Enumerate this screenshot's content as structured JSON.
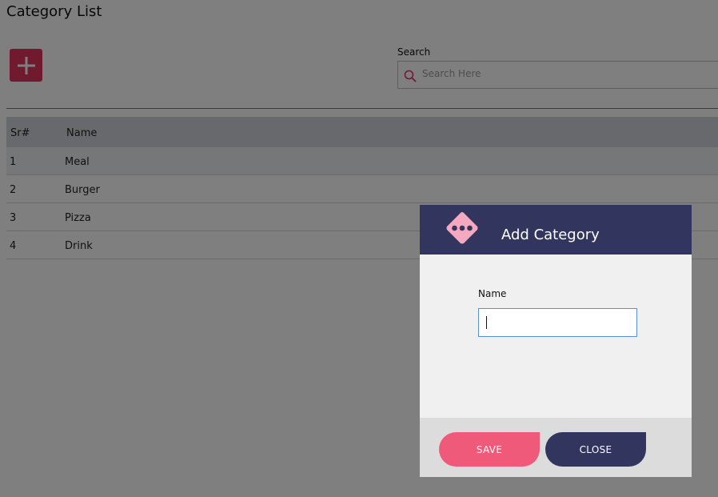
{
  "page": {
    "title": "Category List"
  },
  "toolbar": {
    "add_icon": "plus-icon",
    "add_color": "#e0335f"
  },
  "search": {
    "label": "Search",
    "placeholder": "Search Here",
    "icon": "search-icon"
  },
  "table": {
    "columns": [
      "Sr#",
      "Name"
    ],
    "rows": [
      {
        "sr": "1",
        "name": "Meal"
      },
      {
        "sr": "2",
        "name": "Burger"
      },
      {
        "sr": "3",
        "name": "Pizza"
      },
      {
        "sr": "4",
        "name": "Drink"
      }
    ]
  },
  "modal": {
    "title": "Add Category",
    "logo_icon": "dice-icon",
    "name_label": "Name",
    "name_value": "",
    "save_label": "SAVE",
    "close_label": "CLOSE",
    "colors": {
      "header": "#32355d",
      "save": "#ef5a7b",
      "close": "#32355d"
    }
  }
}
